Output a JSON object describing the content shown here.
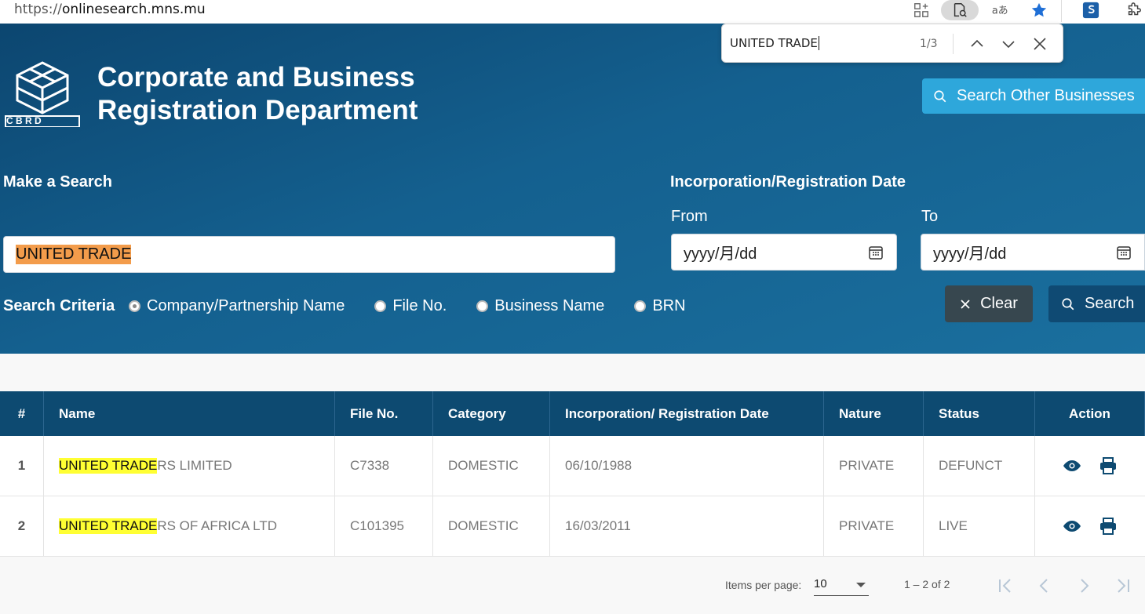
{
  "browser": {
    "url_scheme": "https://",
    "url_host": "onlinesearch.mns.mu"
  },
  "find_bar": {
    "query": "UNITED TRADE",
    "count": "1/3"
  },
  "header": {
    "logo_text": "C B R D",
    "title_line1": "Corporate and Business",
    "title_line2": "Registration Department",
    "other_search_label": "Search Other Businesses"
  },
  "search": {
    "section_label": "Make a Search",
    "query": "UNITED TRADE",
    "date_section_label": "Incorporation/Registration Date",
    "from_label": "From",
    "to_label": "To",
    "from_value": "yyyy/月/dd",
    "to_value": "yyyy/月/dd",
    "criteria_label": "Search Criteria",
    "criteria_options": [
      "Company/Partnership Name",
      "File No.",
      "Business Name",
      "BRN"
    ],
    "criteria_selected": "Company/Partnership Name",
    "clear_label": "Clear",
    "search_label": "Search"
  },
  "table": {
    "columns": [
      "#",
      "Name",
      "File No.",
      "Category",
      "Incorporation/ Registration Date",
      "Nature",
      "Status",
      "Action"
    ],
    "rows": [
      {
        "num": "1",
        "name_match": "UNITED TRADE",
        "name_rest": "RS LIMITED",
        "file_no": "C7338",
        "category": "DOMESTIC",
        "date": "06/10/1988",
        "nature": "PRIVATE",
        "status": "DEFUNCT"
      },
      {
        "num": "2",
        "name_match": "UNITED TRADE",
        "name_rest": "RS OF AFRICA LTD",
        "file_no": "C101395",
        "category": "DOMESTIC",
        "date": "16/03/2011",
        "nature": "PRIVATE",
        "status": "LIVE"
      }
    ]
  },
  "paginator": {
    "items_label": "Items per page:",
    "page_size": "10",
    "range": "1 – 2 of 2"
  },
  "colors": {
    "header_dark": "#0c4670",
    "table_header": "#0d4a71",
    "accent_button": "#2ea7db",
    "find_highlight": "#f39c4b",
    "match_highlight": "#ffff33"
  }
}
